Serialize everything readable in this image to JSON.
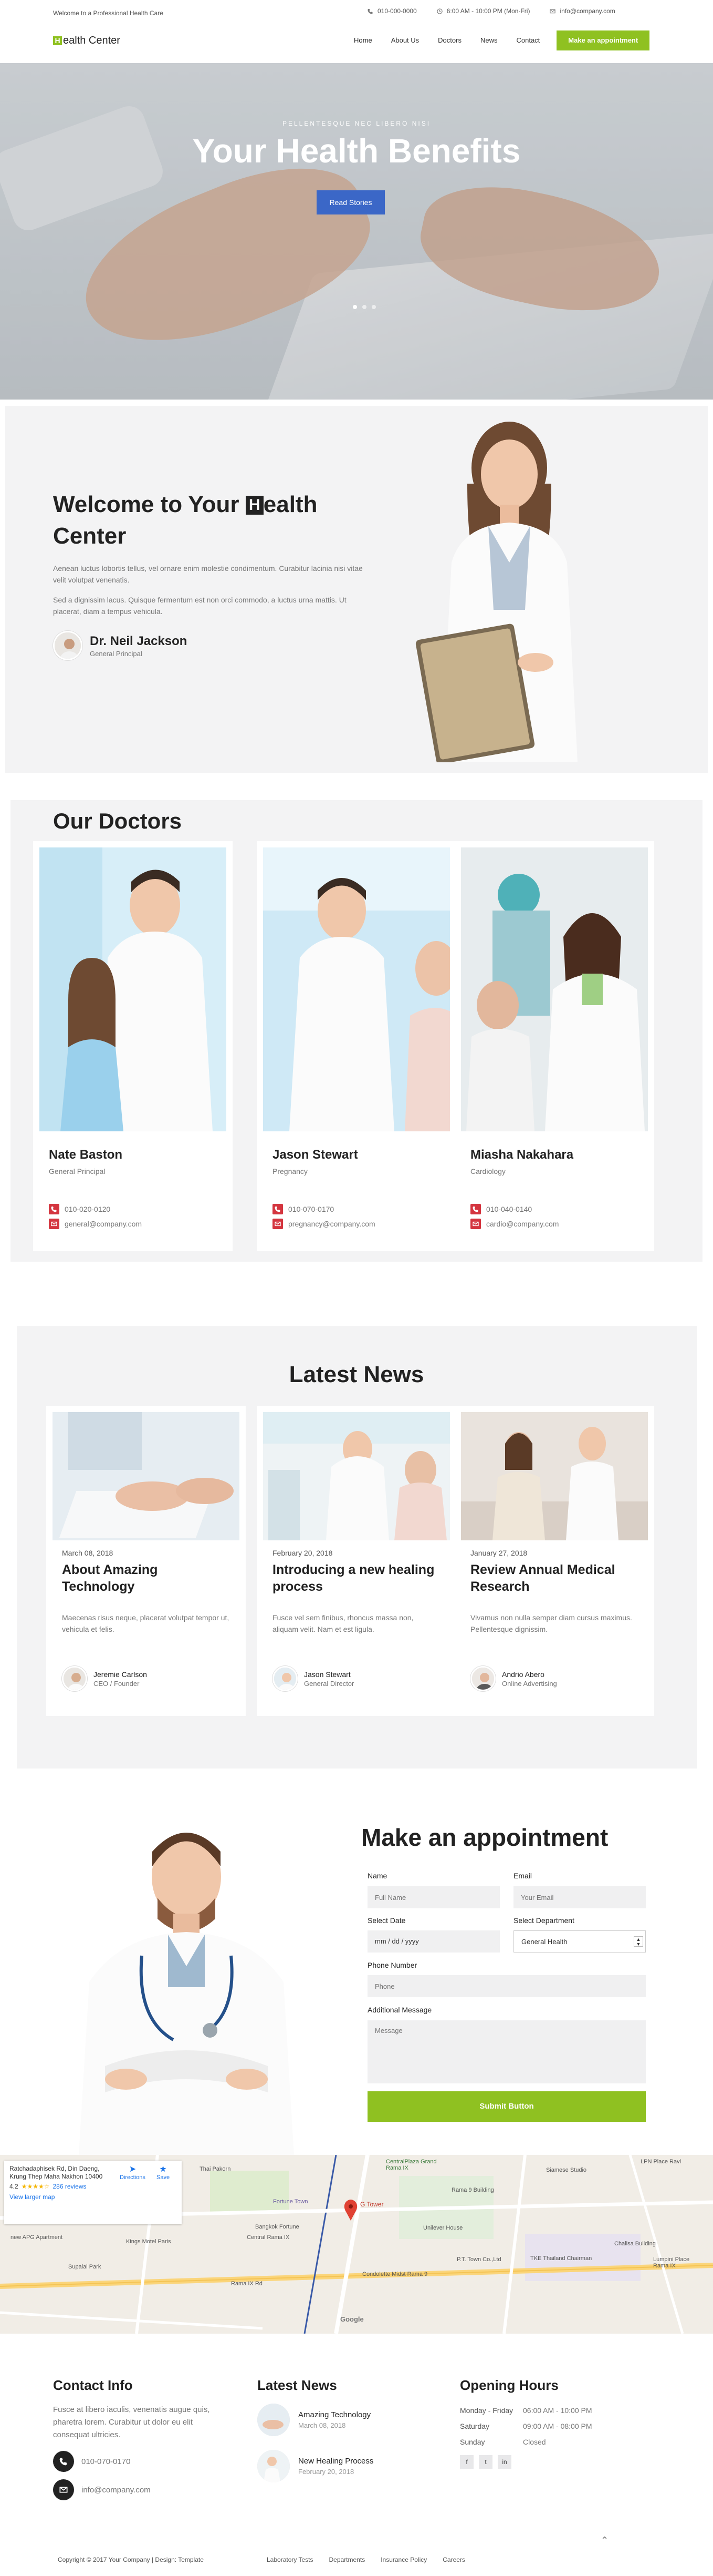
{
  "header": {
    "welcome_text": "Welcome to a Professional Health Care",
    "logo_letter": "H",
    "logo_text": "ealth Center",
    "phone": "010-000-0000",
    "hours": "6:00 AM - 10:00 PM (Mon-Fri)",
    "email": "info@company.com",
    "nav": [
      "Home",
      "About Us",
      "Doctors",
      "News",
      "Contact"
    ],
    "cta": "Make an appointment"
  },
  "hero": {
    "subtitle": "PELLENTESQUE NEC LIBERO NISI",
    "title": "Your Health Benefits",
    "button": "Read Stories",
    "slides": 3,
    "active_slide": 1
  },
  "welcome": {
    "title_before": "Welcome to Your ",
    "title_letter": "H",
    "title_after": "ealth Center",
    "para1": "Aenean luctus lobortis tellus, vel ornare enim molestie condimentum. Curabitur lacinia nisi vitae velit volutpat venenatis.",
    "para2": "Sed a dignissim lacus. Quisque fermentum est non orci commodo, a luctus urna mattis. Ut placerat, diam a tempus vehicula.",
    "author_name": "Dr. Neil Jackson",
    "author_role": "General Principal"
  },
  "doctors": {
    "title": "Our Doctors",
    "items": [
      {
        "name": "Nate Baston",
        "role": "General Principal",
        "phone": "010-020-0120",
        "email": "general@company.com"
      },
      {
        "name": "Jason Stewart",
        "role": "Pregnancy",
        "phone": "010-070-0170",
        "email": "pregnancy@company.com"
      },
      {
        "name": "Miasha Nakahara",
        "role": "Cardiology",
        "phone": "010-040-0140",
        "email": "cardio@company.com"
      }
    ]
  },
  "news": {
    "title": "Latest News",
    "items": [
      {
        "date": "March 08, 2018",
        "title": "About Amazing Technology",
        "text": "Maecenas risus neque, placerat volutpat tempor ut, vehicula et felis.",
        "author": "Jeremie Carlson",
        "author_role": "CEO / Founder"
      },
      {
        "date": "February 20, 2018",
        "title": "Introducing a new healing process",
        "text": "Fusce vel sem finibus, rhoncus massa non, aliquam velit. Nam et est ligula.",
        "author": "Jason Stewart",
        "author_role": "General Director"
      },
      {
        "date": "January 27, 2018",
        "title": "Review Annual Medical Research",
        "text": "Vivamus non nulla semper diam cursus maximus. Pellentesque dignissim.",
        "author": "Andrio Abero",
        "author_role": "Online Advertising"
      }
    ]
  },
  "appointment": {
    "title": "Make an appointment",
    "name_label": "Name",
    "name_placeholder": "Full Name",
    "email_label": "Email",
    "email_placeholder": "Your Email",
    "date_label": "Select Date",
    "date_placeholder": "mm / dd / yyyy",
    "dept_label": "Select Department",
    "dept_value": "General Health",
    "phone_label": "Phone Number",
    "phone_placeholder": "Phone",
    "msg_label": "Additional Message",
    "msg_placeholder": "Message",
    "submit": "Submit Button"
  },
  "map": {
    "address": "Ratchadaphisek Rd, Din Daeng, Krung Thep Maha Nakhon 10400",
    "rating": "4.2",
    "stars": "★★★★☆",
    "reviews": "286 reviews",
    "larger": "View larger map",
    "directions": "Directions",
    "save": "Save",
    "place": "G Tower",
    "labels": [
      "CentralPlaza Grand Rama IX",
      "Fortune Town",
      "Siamese Studio",
      "LPN Place Ravi",
      "Rama 9 Building",
      "Unilever House",
      "Thai Pakorn",
      "Bangkok Fortune",
      "Kings Motel Paris",
      "Central Rama IX",
      "Chalisa Building",
      "P.T. Town Co.,Ltd",
      "TKE Thailand Chairman",
      "Lumpini Place Rama IX",
      "Supalai Park",
      "Condolette Midst Rama 9",
      "new APG Apartment",
      "Rama IX Rd",
      "Google"
    ]
  },
  "footer": {
    "contact_title": "Contact Info",
    "contact_text": "Fusce at libero iaculis, venenatis augue quis, pharetra lorem. Curabitur ut dolor eu elit consequat ultricies.",
    "phone": "010-070-0170",
    "email": "info@company.com",
    "news_title": "Latest News",
    "news": [
      {
        "title": "Amazing Technology",
        "date": "March 08, 2018"
      },
      {
        "title": "New Healing Process",
        "date": "February 20, 2018"
      }
    ],
    "hours_title": "Opening Hours",
    "hours": [
      {
        "day": "Monday - Friday",
        "time": "06:00 AM - 10:00 PM"
      },
      {
        "day": "Saturday",
        "time": "09:00 AM - 08:00 PM"
      },
      {
        "day": "Sunday",
        "time": "Closed"
      }
    ],
    "social": [
      "f",
      "t",
      "in"
    ],
    "copyright": "Copyright © 2017 Your Company | Design: Template",
    "links": [
      "Laboratory Tests",
      "Departments",
      "Insurance Policy",
      "Careers"
    ]
  },
  "colors": {
    "accent_green": "#8fc121",
    "button_blue": "#3b67c7",
    "icon_red": "#d4353f"
  }
}
